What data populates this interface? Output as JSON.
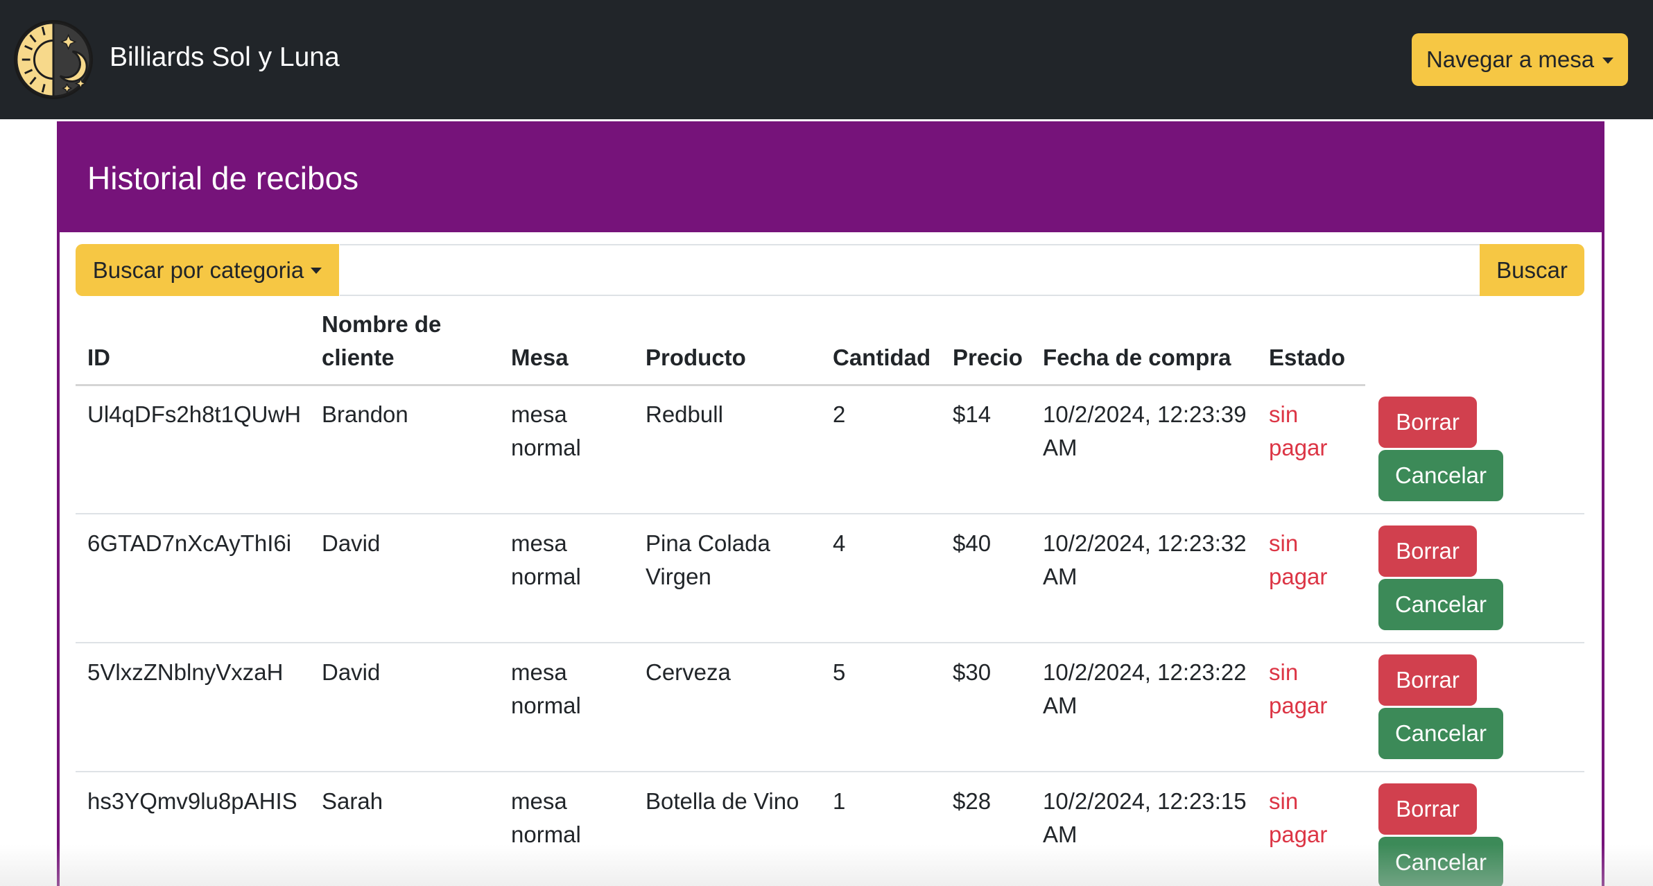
{
  "navbar": {
    "brand": "Billiards Sol y Luna",
    "nav_button": "Navegar a mesa"
  },
  "page": {
    "title": "Historial de recibos"
  },
  "search": {
    "category_button": "Buscar por categoria",
    "input_value": "",
    "search_button": "Buscar"
  },
  "table": {
    "headers": {
      "id": "ID",
      "client_line1": "Nombre de",
      "client_line2": "cliente",
      "table": "Mesa",
      "product": "Producto",
      "quantity": "Cantidad",
      "price": "Precio",
      "date": "Fecha de compra",
      "status": "Estado"
    },
    "rows": [
      {
        "id": "Ul4qDFs2h8t1QUwH",
        "client": "Brandon",
        "table_1": "mesa",
        "table_2": "normal",
        "product_1": "Redbull",
        "product_2": "",
        "quantity": "2",
        "price": "$14",
        "date_1": "10/2/2024, 12:23:39",
        "date_2": "AM",
        "status_1": "sin",
        "status_2": "pagar",
        "delete": "Borrar",
        "cancel": "Cancelar"
      },
      {
        "id": "6GTAD7nXcAyThI6i",
        "client": "David",
        "table_1": "mesa",
        "table_2": "normal",
        "product_1": "Pina Colada",
        "product_2": "Virgen",
        "quantity": "4",
        "price": "$40",
        "date_1": "10/2/2024, 12:23:32",
        "date_2": "AM",
        "status_1": "sin",
        "status_2": "pagar",
        "delete": "Borrar",
        "cancel": "Cancelar"
      },
      {
        "id": "5VlxzZNblnyVxzaH",
        "client": "David",
        "table_1": "mesa",
        "table_2": "normal",
        "product_1": "Cerveza",
        "product_2": "",
        "quantity": "5",
        "price": "$30",
        "date_1": "10/2/2024, 12:23:22",
        "date_2": "AM",
        "status_1": "sin",
        "status_2": "pagar",
        "delete": "Borrar",
        "cancel": "Cancelar"
      },
      {
        "id": "hs3YQmv9lu8pAHIS",
        "client": "Sarah",
        "table_1": "mesa",
        "table_2": "normal",
        "product_1": "Botella de Vino",
        "product_2": "",
        "quantity": "1",
        "price": "$28",
        "date_1": "10/2/2024, 12:23:15",
        "date_2": "AM",
        "status_1": "sin",
        "status_2": "pagar",
        "delete": "Borrar",
        "cancel": "Cancelar"
      }
    ]
  },
  "colors": {
    "navbar_bg": "#212529",
    "header_purple": "#76137a",
    "accent_yellow": "#f6c744",
    "danger_red": "#d1404e",
    "success_green": "#3c8a58",
    "status_red": "#dc3545"
  },
  "icons": {
    "logo": "sun-moon-logo-icon",
    "dropdown": "caret-down-icon"
  }
}
